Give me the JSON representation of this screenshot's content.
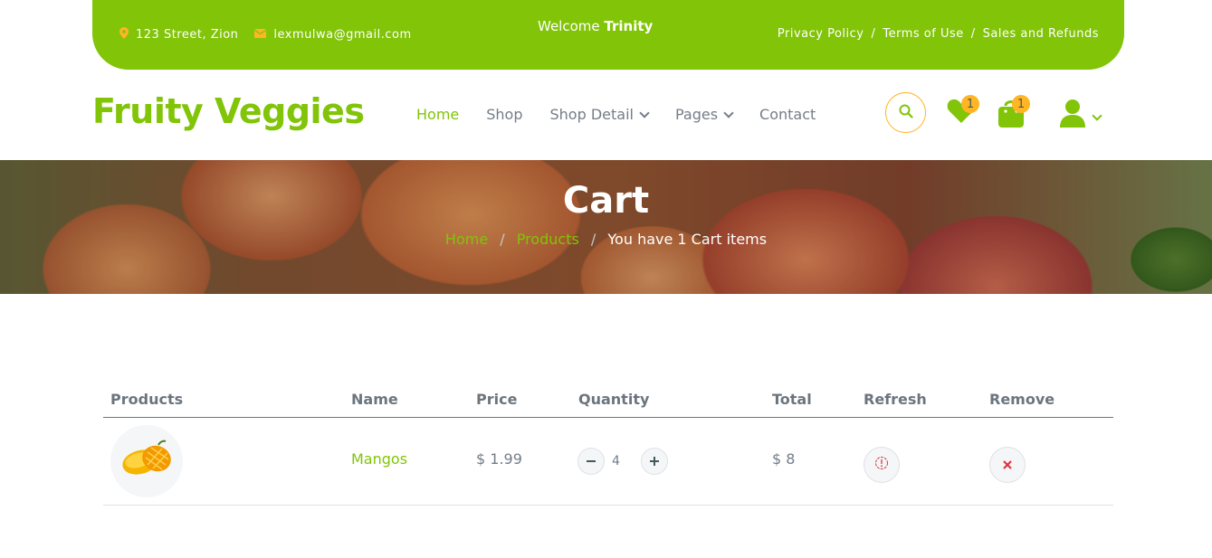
{
  "topbar": {
    "address": "123 Street, Zion",
    "email": "lexmulwa@gmail.com",
    "welcome_prefix": "Welcome",
    "welcome_user": "Trinity",
    "links": [
      "Privacy Policy",
      "Terms of Use",
      "Sales and Refunds"
    ],
    "separator": "/"
  },
  "header": {
    "logo": "Fruity Veggies",
    "nav": [
      {
        "label": "Home",
        "active": true
      },
      {
        "label": "Shop"
      },
      {
        "label": "Shop Detail",
        "dropdown": true
      },
      {
        "label": "Pages",
        "dropdown": true
      },
      {
        "label": "Contact"
      }
    ],
    "wishlist_count": "1",
    "cart_count": "1"
  },
  "banner": {
    "title": "Cart",
    "breadcrumb": [
      "Home",
      "Products",
      "You have 1 Cart items"
    ],
    "separator": "/"
  },
  "table": {
    "headers": [
      "Products",
      "Name",
      "Price",
      "Quantity",
      "Total",
      "Refresh",
      "Remove"
    ],
    "rows": [
      {
        "name": "Mangos",
        "price": "$ 1.99",
        "quantity": "4",
        "total": "$ 8"
      }
    ]
  },
  "colors": {
    "primary": "#81c408",
    "secondary": "#ffb524",
    "text": "#747d88",
    "danger": "#dc3545"
  },
  "icons": [
    "map-marker-icon",
    "envelope-icon",
    "chevron-down-icon",
    "search-icon",
    "heart-icon",
    "shopping-bag-icon",
    "user-icon",
    "minus-icon",
    "plus-icon",
    "refresh-icon",
    "close-icon",
    "mango-image"
  ]
}
